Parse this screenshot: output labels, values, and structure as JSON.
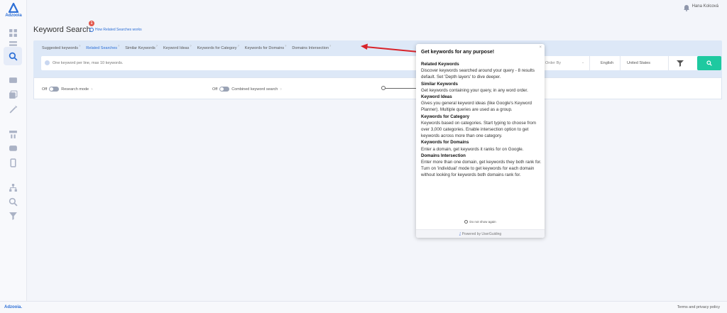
{
  "app": {
    "logo_text": "Adzooia",
    "user_name": "Hana Kolcová"
  },
  "page": {
    "title": "Keyword Search",
    "help_badge": "1",
    "help_link": "How Related Searches works"
  },
  "tabs": [
    {
      "label": "Suggested keywords",
      "active": false
    },
    {
      "label": "Related Searches",
      "active": true
    },
    {
      "label": "Similar Keywords",
      "active": false
    },
    {
      "label": "Keyword Ideas",
      "active": false
    },
    {
      "label": "Keywords for Category",
      "active": false
    },
    {
      "label": "Keywords for Domains",
      "active": false
    },
    {
      "label": "Domains Intersection",
      "active": false
    }
  ],
  "search": {
    "placeholder": "One keyword per line, max 10 keywords.",
    "order_by": "Order By",
    "language": "English",
    "country": "United States"
  },
  "options": {
    "research_mode_state": "Off",
    "research_mode_label": "Research mode",
    "combined_state": "Off",
    "combined_label": "Combined keyword search"
  },
  "tooltip": {
    "title": "Get keywords for any purpose!",
    "close": "×",
    "sections": [
      {
        "heading": "Related Keywords",
        "text": "Discover keywords searched around your query - 8 results default. Set 'Depth layers' to dive deeper."
      },
      {
        "heading": "Similar Keywords",
        "text": "Get keywords containing your query, in any word order."
      },
      {
        "heading": "Keyword Ideas",
        "text": "Gives you general keyword ideas (like Google's Keyword Planner). Multiple queries are used as a group."
      },
      {
        "heading": "Keywords for Category",
        "text": "Keywords based on categories. Start typing to choose from over 3,000 categories. Enable intersection option to get keywords across more than one category."
      },
      {
        "heading": "Keywords for Domains",
        "text": "Enter a domain, get keywords it ranks for on Google."
      },
      {
        "heading": "Domains Intersection",
        "text": "Enter more than one domain, get keywords they both rank for. Turn on 'individual' mode to get keywords for each domain without looking for keywords both domains rank for."
      }
    ],
    "dont_show": "Do not show again",
    "powered_by": "Powered by UserGuiding"
  },
  "footer": {
    "brand": "Adzooia.",
    "link": "Terms and privacy policy"
  },
  "colors": {
    "accent": "#2d6fd6",
    "search_button": "#1ec9a0",
    "arrow": "#d8232a",
    "badge": "#e2574c"
  },
  "icons": {
    "sidebar": [
      "dashboard-icon",
      "list-icon",
      "search-icon",
      "card-icon",
      "copy-icon",
      "wand-icon",
      "hierarchy-icon",
      "chat-icon",
      "mobile-icon",
      "sitemap-icon",
      "zoom-icon",
      "filter-x-icon"
    ],
    "topbar": "bell-icon",
    "search_button": "search-icon",
    "filter": "funnel-icon"
  }
}
